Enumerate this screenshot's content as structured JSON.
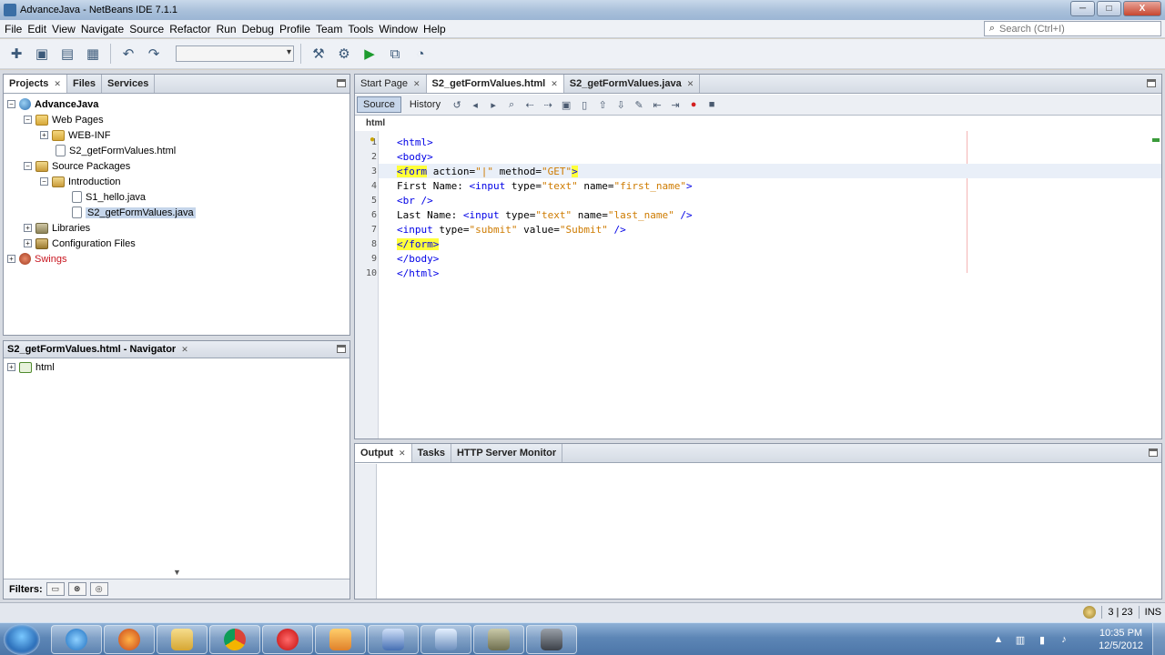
{
  "window": {
    "title": "AdvanceJava - NetBeans IDE 7.1.1",
    "minimize_label": "─",
    "maximize_label": "□",
    "close_label": "X"
  },
  "menu": [
    "File",
    "Edit",
    "View",
    "Navigate",
    "Source",
    "Refactor",
    "Run",
    "Debug",
    "Profile",
    "Team",
    "Tools",
    "Window",
    "Help"
  ],
  "search": {
    "placeholder": "Search (Ctrl+I)"
  },
  "projects_panel": {
    "tabs": [
      "Projects",
      "Files",
      "Services"
    ],
    "tree": [
      {
        "label": "AdvanceJava"
      },
      {
        "label": "Web Pages"
      },
      {
        "label": "WEB-INF"
      },
      {
        "label": "S2_getFormValues.html"
      },
      {
        "label": "Source Packages"
      },
      {
        "label": "Introduction"
      },
      {
        "label": "S1_hello.java"
      },
      {
        "label": "S2_getFormValues.java"
      },
      {
        "label": "Libraries"
      },
      {
        "label": "Configuration Files"
      },
      {
        "label": "Swings"
      }
    ]
  },
  "navigator": {
    "title": "S2_getFormValues.html - Navigator",
    "root": "html",
    "filters_label": "Filters:"
  },
  "editor": {
    "tabs": [
      "Start Page",
      "S2_getFormValues.html",
      "S2_getFormValues.java"
    ],
    "source_label": "Source",
    "history_label": "History",
    "breadcrumb": "html",
    "line_numbers": [
      "1",
      "2",
      "3",
      "4",
      "5",
      "6",
      "7",
      "8",
      "9",
      "10"
    ],
    "code": {
      "l1": "<html>",
      "l2": "<body>",
      "l3_tag": "<form",
      "l3_a1": " action=",
      "l3_v1": "\"|\"",
      "l3_a2": " method=",
      "l3_v2": "\"GET\"",
      "l3_end": ">",
      "l4_text": "First Name: ",
      "l4_tag": "<input",
      "l4_a1": " type=",
      "l4_v1": "\"text\"",
      "l4_a2": " name=",
      "l4_v2": "\"first_name\"",
      "l4_end": ">",
      "l5": "<br />",
      "l6_text": "Last Name: ",
      "l6_tag": "<input",
      "l6_a1": " type=",
      "l6_v1": "\"text\"",
      "l6_a2": " name=",
      "l6_v2": "\"last_name\"",
      "l6_end": " />",
      "l7_tag": "<input",
      "l7_a1": " type=",
      "l7_v1": "\"submit\"",
      "l7_a2": " value=",
      "l7_v2": "\"Submit\"",
      "l7_end": " />",
      "l8": "</form>",
      "l9": "</body>",
      "l10": "</html>"
    }
  },
  "output_panel": {
    "tabs": [
      "Output",
      "Tasks",
      "HTTP Server Monitor"
    ]
  },
  "status": {
    "position": "3 | 23",
    "mode": "INS"
  },
  "taskbar": {
    "time": "10:35 PM",
    "date": "12/5/2012"
  }
}
